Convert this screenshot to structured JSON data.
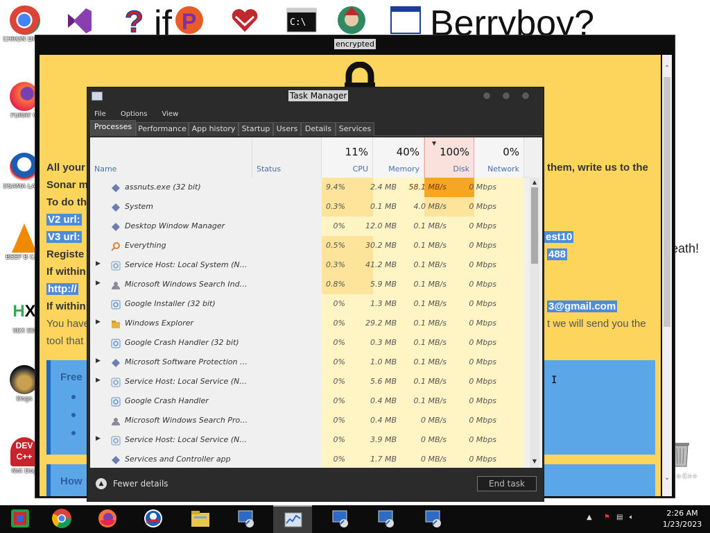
{
  "desktop": {
    "wallpaper_if": "if",
    "wallpaper_text": "Berryboy?",
    "death_text": "eath!",
    "icons": [
      {
        "label": "CHRON DISEA"
      },
      {
        "label": "FURRY G"
      },
      {
        "label": "OSAMA LADEN"
      },
      {
        "label": "BEEP B CAR"
      },
      {
        "label": "SEX ED"
      },
      {
        "label": "Dogs"
      },
      {
        "label": "Not Dog"
      }
    ],
    "recycle_label": "n C++"
  },
  "encrypted_window": {
    "title": "encrypted",
    "lines": {
      "l1a": "All your",
      "l1b": "them, write us to the",
      "l2": "Sonar m",
      "l3": "To do th",
      "l4": "V2 url:",
      "l5": "V3 url:",
      "l5b": "est10",
      "l6": "Registe",
      "l6b": "488",
      "l7": "If within",
      "l8": "http://",
      "l9": "If within",
      "l9b": "3@gmail.com",
      "l10a": "You have",
      "l10b": "t we will send you the",
      "l11": "tool that"
    },
    "panel1_title": "Free",
    "panel2_title": "How"
  },
  "task_manager": {
    "title": "Task Manager",
    "menu": [
      "File",
      "Options",
      "View"
    ],
    "tabs": [
      "Processes",
      "Performance",
      "App history",
      "Startup",
      "Users",
      "Details",
      "Services"
    ],
    "columns": {
      "name": "Name",
      "status": "Status",
      "cpu_pct": "11%",
      "cpu": "CPU",
      "memory_pct": "40%",
      "memory": "Memory",
      "disk_pct": "100%",
      "disk": "Disk",
      "network_pct": "0%",
      "network": "Network"
    },
    "processes": [
      {
        "name": "assnuts.exe (32 bit)",
        "cpu": "9.4%",
        "memory": "2.4 MB",
        "disk": "58.1 MB/s",
        "network": "0 Mbps"
      },
      {
        "name": "System",
        "cpu": "0.3%",
        "memory": "0.1 MB",
        "disk": "4.0 MB/s",
        "network": "0 Mbps"
      },
      {
        "name": "Desktop Window Manager",
        "cpu": "0%",
        "memory": "12.0 MB",
        "disk": "0.1 MB/s",
        "network": "0 Mbps"
      },
      {
        "name": "Everything",
        "cpu": "0.5%",
        "memory": "30.2 MB",
        "disk": "0.1 MB/s",
        "network": "0 Mbps"
      },
      {
        "name": "Service Host: Local System (Netw...",
        "cpu": "0.3%",
        "memory": "41.2 MB",
        "disk": "0.1 MB/s",
        "network": "0 Mbps"
      },
      {
        "name": "Microsoft Windows Search Indexer",
        "cpu": "0.8%",
        "memory": "5.9 MB",
        "disk": "0.1 MB/s",
        "network": "0 Mbps"
      },
      {
        "name": "Google Installer (32 bit)",
        "cpu": "0%",
        "memory": "1.3 MB",
        "disk": "0.1 MB/s",
        "network": "0 Mbps"
      },
      {
        "name": "Windows Explorer",
        "cpu": "0%",
        "memory": "29.2 MB",
        "disk": "0.1 MB/s",
        "network": "0 Mbps"
      },
      {
        "name": "Google Crash Handler (32 bit)",
        "cpu": "0%",
        "memory": "0.3 MB",
        "disk": "0.1 MB/s",
        "network": "0 Mbps"
      },
      {
        "name": "Microsoft Software Protection Plat...",
        "cpu": "0%",
        "memory": "1.0 MB",
        "disk": "0.1 MB/s",
        "network": "0 Mbps"
      },
      {
        "name": "Service Host: Local Service (Netw...",
        "cpu": "0%",
        "memory": "5.6 MB",
        "disk": "0.1 MB/s",
        "network": "0 Mbps"
      },
      {
        "name": "Google Crash Handler",
        "cpu": "0%",
        "memory": "0.4 MB",
        "disk": "0.1 MB/s",
        "network": "0 Mbps"
      },
      {
        "name": "Microsoft Windows Search Protoco...",
        "cpu": "0%",
        "memory": "0.4 MB",
        "disk": "0 MB/s",
        "network": "0 Mbps"
      },
      {
        "name": "Service Host: Local Service (No N...",
        "cpu": "0%",
        "memory": "3.9 MB",
        "disk": "0 MB/s",
        "network": "0 Mbps"
      },
      {
        "name": "Services and Controller app",
        "cpu": "0%",
        "memory": "1.7 MB",
        "disk": "0 MB/s",
        "network": "0 Mbps"
      }
    ],
    "fewer_details": "Fewer details",
    "end_task": "End task"
  },
  "taskbar": {
    "time": "2:26 AM",
    "date": "1/23/2023"
  },
  "colors": {
    "heat_high": "#f5a623",
    "heat_mid": "#fde49a",
    "heat_low": "#fff4c4",
    "yellow_bg": "#fdd45c"
  }
}
